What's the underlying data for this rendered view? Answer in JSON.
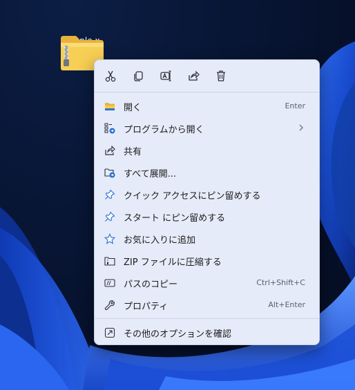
{
  "desktop": {
    "file_label": "sample.x",
    "colors": {
      "background": "#081635",
      "bloom": "#1f5ae6"
    }
  },
  "toolbar": {
    "buttons": [
      {
        "icon": "cut-icon"
      },
      {
        "icon": "copy-icon"
      },
      {
        "icon": "rename-icon"
      },
      {
        "icon": "share-icon"
      },
      {
        "icon": "delete-icon"
      }
    ]
  },
  "menu": {
    "items": [
      {
        "label": "開く",
        "shortcut": "Enter",
        "icon": "open-folder-icon"
      },
      {
        "label": "プログラムから開く",
        "shortcut": "",
        "icon": "open-with-icon",
        "submenu": true
      },
      {
        "label": "共有",
        "shortcut": "",
        "icon": "share-icon"
      },
      {
        "label": "すべて展開...",
        "shortcut": "",
        "icon": "extract-all-icon"
      },
      {
        "label": "クイック アクセスにピン留めする",
        "shortcut": "",
        "icon": "pin-icon"
      },
      {
        "label": "スタート にピン留めする",
        "shortcut": "",
        "icon": "pin-icon"
      },
      {
        "label": "お気に入りに追加",
        "shortcut": "",
        "icon": "star-icon"
      },
      {
        "label": "ZIP ファイルに圧縮する",
        "shortcut": "",
        "icon": "zip-icon"
      },
      {
        "label": "パスのコピー",
        "shortcut": "Ctrl+Shift+C",
        "icon": "copy-path-icon"
      },
      {
        "label": "プロパティ",
        "shortcut": "Alt+Enter",
        "icon": "wrench-icon"
      },
      {
        "label": "その他のオプションを確認",
        "shortcut": "",
        "icon": "more-options-icon"
      }
    ]
  }
}
